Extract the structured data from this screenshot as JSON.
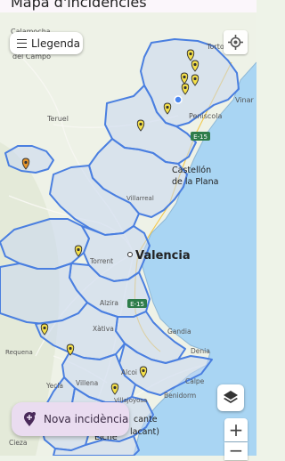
{
  "app": {
    "title": "Mapa d'incidències"
  },
  "controls": {
    "legend_label": "Llegenda",
    "new_incident_label": "Nova incidència",
    "zoom_in": "+",
    "zoom_out": "−"
  },
  "map_labels": {
    "calamocha": "Calamocha",
    "del_campo": "del Campo",
    "tortosa": "Torto",
    "vinaros": "Vinar",
    "peniscola": "Peníscola",
    "teruel": "Teruel",
    "e15_north": "E-15",
    "castellon_1": "Castellón",
    "castellon_2": "de la Plana",
    "villarreal": "Villarreal",
    "valencia": "Valencia",
    "torrent": "Torrent",
    "alzira": "Alzira",
    "e15_south": "E-15",
    "gandia": "Gandia",
    "xativa": "Xàtiva",
    "denia": "Denia",
    "requena": "Requena",
    "alcoi": "Alcoi",
    "calpe": "Calpe",
    "yecla": "Yecla",
    "villena": "Villena",
    "villajoyosa": "Villajoyosa",
    "benidorm": "Benidorm",
    "alicante_1": "cante",
    "alicante_2": "lacant)",
    "elche": "Elche",
    "cieza": "Cieza"
  },
  "markers": {
    "count_yellow": 13,
    "count_orange": 1,
    "marker_colors": {
      "incident": "#f5e04a",
      "selected": "#e8962a"
    }
  },
  "colors": {
    "region_border": "#4a7fe0",
    "region_fill": "#c8d6f0",
    "sea": "#a8d4f2",
    "land": "#eef3e8",
    "fab_bg": "#eadcf0"
  }
}
